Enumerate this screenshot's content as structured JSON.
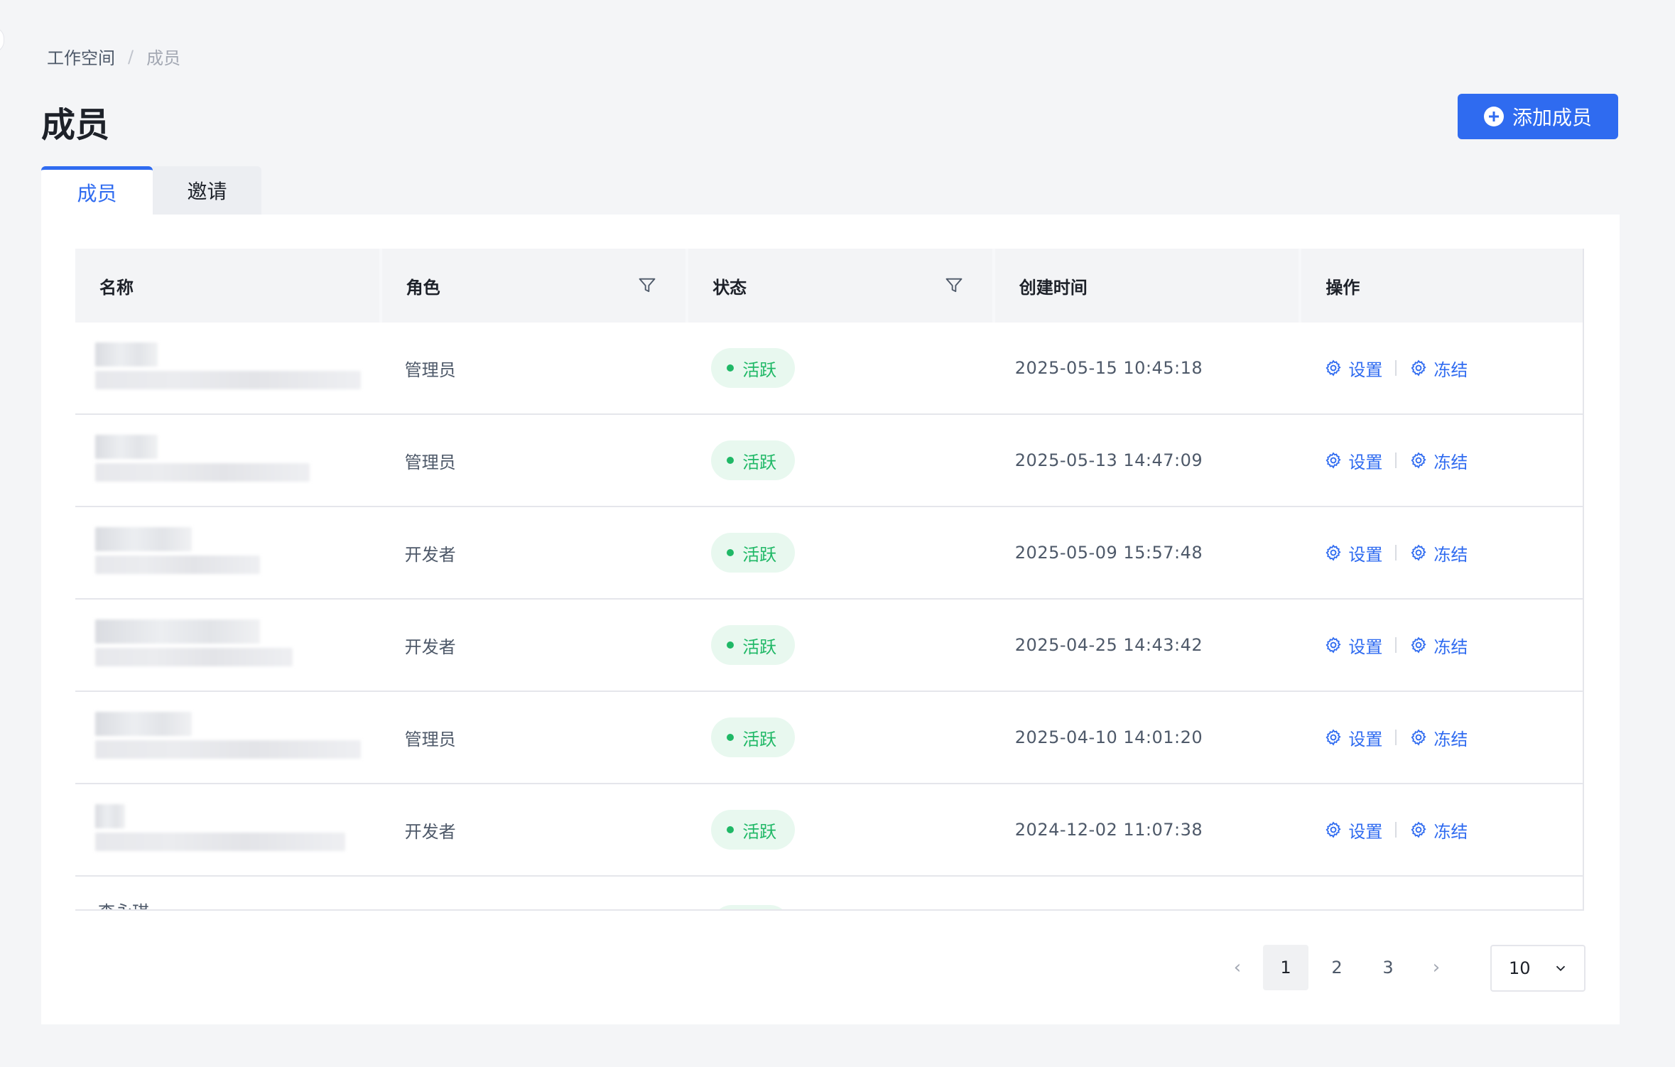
{
  "breadcrumb": {
    "root": "工作空间",
    "separator": "/",
    "current": "成员"
  },
  "page_title": "成员",
  "add_button": {
    "label": "添加成员"
  },
  "tabs": [
    {
      "label": "成员",
      "active": true
    },
    {
      "label": "邀请",
      "active": false
    }
  ],
  "table": {
    "columns": {
      "name": "名称",
      "role": "角色",
      "status": "状态",
      "created": "创建时间",
      "ops": "操作"
    },
    "rows": [
      {
        "name_w1": 88,
        "name_w2": 374,
        "role": "管理员",
        "status": "活跃",
        "created": "2025-05-15 10:45:18",
        "op_settings": "设置",
        "op_freeze": "冻结"
      },
      {
        "name_w1": 88,
        "name_w2": 302,
        "role": "管理员",
        "status": "活跃",
        "created": "2025-05-13 14:47:09",
        "op_settings": "设置",
        "op_freeze": "冻结"
      },
      {
        "name_w1": 136,
        "name_w2": 232,
        "role": "开发者",
        "status": "活跃",
        "created": "2025-05-09 15:57:48",
        "op_settings": "设置",
        "op_freeze": "冻结"
      },
      {
        "name_w1": 232,
        "name_w2": 278,
        "role": "开发者",
        "status": "活跃",
        "created": "2025-04-25 14:43:42",
        "op_settings": "设置",
        "op_freeze": "冻结"
      },
      {
        "name_w1": 136,
        "name_w2": 374,
        "role": "管理员",
        "status": "活跃",
        "created": "2025-04-10 14:01:20",
        "op_settings": "设置",
        "op_freeze": "冻结"
      },
      {
        "name_w1": 42,
        "name_w2": 352,
        "role": "开发者",
        "status": "活跃",
        "created": "2024-12-02 11:07:38",
        "op_settings": "设置",
        "op_freeze": "冻结"
      }
    ],
    "partial_row_name": "李永琪"
  },
  "pagination": {
    "prev": "‹",
    "next": "›",
    "pages": [
      "1",
      "2",
      "3"
    ],
    "current": "1",
    "page_size": "10"
  },
  "colors": {
    "primary": "#2f6bf0",
    "active_status": "#1fb866",
    "active_status_bg": "#e8f8ef"
  },
  "icons": {
    "filter": "filter-icon",
    "settings": "gear-icon",
    "freeze": "gear-icon",
    "add": "plus-circle-icon",
    "page_size_caret": "chevron-down-icon"
  }
}
